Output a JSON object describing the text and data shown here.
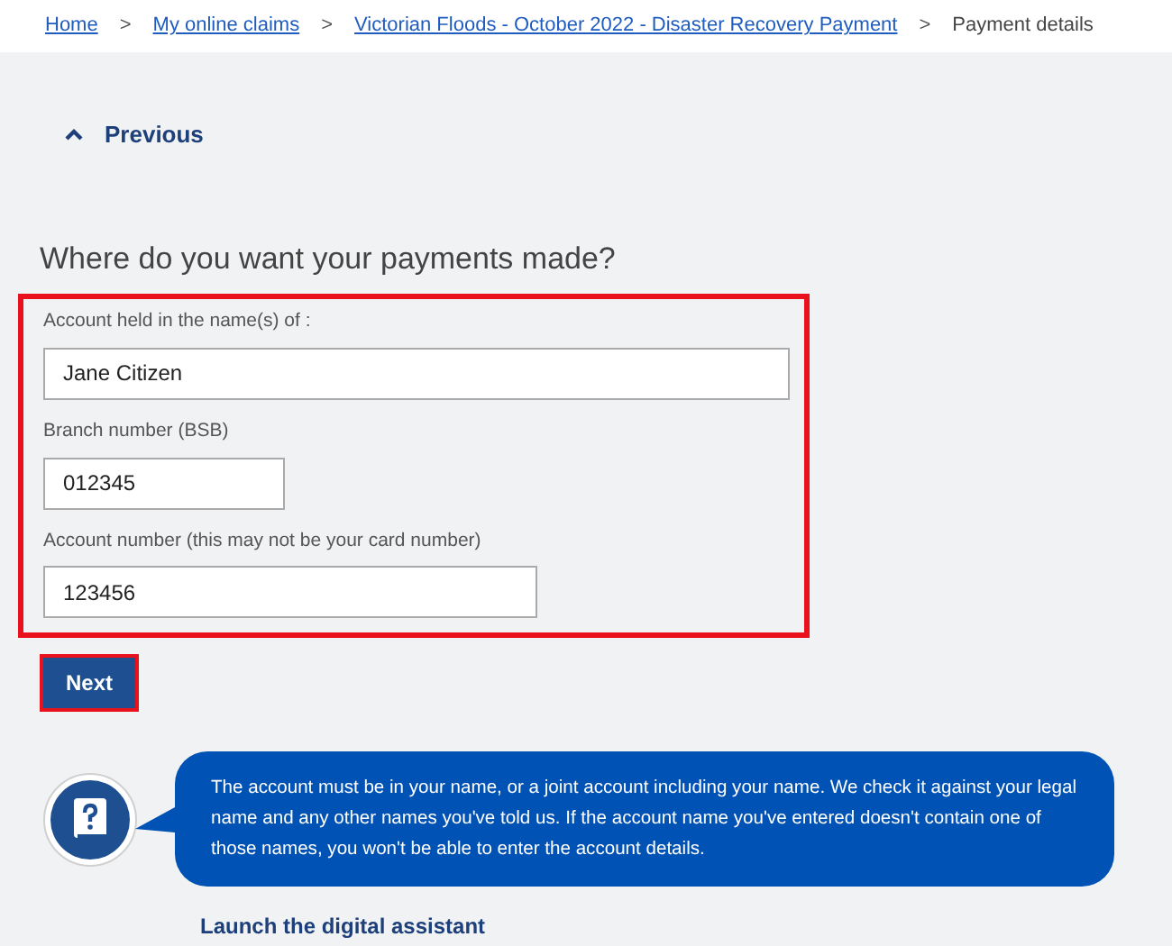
{
  "breadcrumbs": {
    "separator": ">",
    "items": [
      {
        "label": "Home",
        "kind": "link"
      },
      {
        "label": "My online claims",
        "kind": "link"
      },
      {
        "label": "Victorian Floods - October 2022 - Disaster Recovery Payment",
        "kind": "link"
      },
      {
        "label": "Payment details",
        "kind": "current"
      }
    ]
  },
  "previous_link": {
    "label": "Previous"
  },
  "heading": "Where do you want your payments made?",
  "form": {
    "highlighted": true,
    "fields": [
      {
        "label": "Account held in the name(s) of :",
        "value": "Jane Citizen"
      },
      {
        "label": "Branch number (BSB)",
        "value": "012345"
      },
      {
        "label": "Account number (this may not be your card number)",
        "value": "123456"
      }
    ]
  },
  "next_button": {
    "label": "Next",
    "highlighted": true
  },
  "help": {
    "message": "The account must be in your name, or a joint account including your name. We check it against your legal name and any other names you've told us. If the account name you've entered doesn't contain one of those names, you won't be able to enter the account details.",
    "link": "Launch the digital assistant"
  }
}
